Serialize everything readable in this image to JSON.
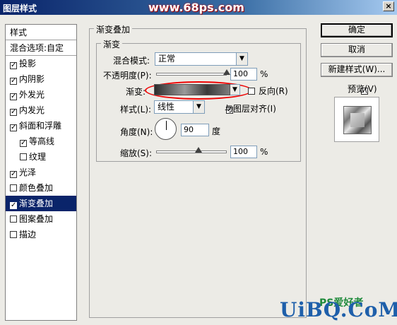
{
  "window": {
    "title": "图层样式",
    "watermark_top": "www.68ps.com",
    "close_glyph": "×"
  },
  "left_panel": {
    "items": [
      {
        "label": "样式",
        "checkbox": null
      },
      {
        "label": "混合选项:自定",
        "checkbox": null
      },
      {
        "label": "投影",
        "checkbox": true
      },
      {
        "label": "内阴影",
        "checkbox": true
      },
      {
        "label": "外发光",
        "checkbox": true
      },
      {
        "label": "内发光",
        "checkbox": true
      },
      {
        "label": "斜面和浮雕",
        "checkbox": true
      },
      {
        "label": "等高线",
        "checkbox": true
      },
      {
        "label": "纹理",
        "checkbox": false
      },
      {
        "label": "光泽",
        "checkbox": true
      },
      {
        "label": "颜色叠加",
        "checkbox": false
      },
      {
        "label": "渐变叠加",
        "checkbox": true
      },
      {
        "label": "图案叠加",
        "checkbox": false
      },
      {
        "label": "描边",
        "checkbox": false
      }
    ],
    "check_glyph": "✓"
  },
  "main": {
    "group_title": "渐变叠加",
    "sub_group_title": "渐变",
    "blend_mode_label": "混合模式:",
    "blend_mode_value": "正常",
    "opacity_label": "不透明度(P):",
    "opacity_value": "100",
    "opacity_level": 1.0,
    "percent": "%",
    "gradient_label": "渐变:",
    "reverse_label": "反向(R)",
    "reverse_checked": false,
    "style_label": "样式(L):",
    "style_value": "线性",
    "align_label": "与图层对齐(I)",
    "align_checked": true,
    "angle_label": "角度(N):",
    "angle_value": "90",
    "degree": "度",
    "scale_label": "缩放(S):",
    "scale_value": "100",
    "scale_level": 0.5
  },
  "right": {
    "ok": "确定",
    "cancel": "取消",
    "new_style": "新建样式(W)...",
    "preview_label": "预览(V)",
    "preview_checked": true
  },
  "watermark_bottom": {
    "logo": "UiBQ.CoM",
    "sub": "PS爱好者"
  },
  "dropdown_arrow": "▼"
}
